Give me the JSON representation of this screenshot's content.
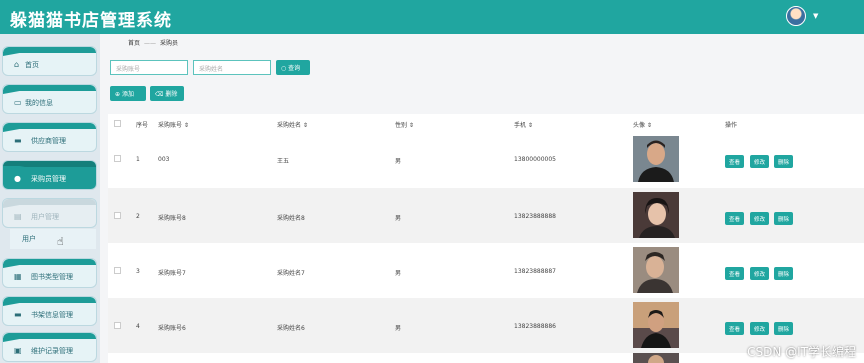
{
  "header": {
    "title": "躲猫猫书店管理系统"
  },
  "sidebar": {
    "items": [
      {
        "label": "首页",
        "icon": "home-icon"
      },
      {
        "label": "我的信息",
        "icon": "profile-icon"
      },
      {
        "label": "供应商管理",
        "icon": "supplier-icon"
      },
      {
        "label": "采购员管理",
        "icon": "user-icon"
      },
      {
        "label": "用户管理",
        "icon": "users-icon"
      },
      {
        "label": "图书类型管理",
        "icon": "grid-icon"
      },
      {
        "label": "书架信息管理",
        "icon": "shelf-icon"
      },
      {
        "label": "维护记录管理",
        "icon": "record-icon"
      }
    ],
    "sub_item": {
      "label": "用户"
    }
  },
  "breadcrumb": {
    "home": "首页",
    "sep": "——",
    "current": "采购员"
  },
  "search": {
    "account_placeholder": "采购账号",
    "name_placeholder": "采购姓名",
    "query_label": "查询"
  },
  "toolbar": {
    "add_label": "添加",
    "delete_label": "删除"
  },
  "table": {
    "headers": [
      "序号",
      "采购账号",
      "采购姓名",
      "性别",
      "手机",
      "头像",
      "操作"
    ],
    "rows": [
      {
        "index": "1",
        "account": "003",
        "name": "王五",
        "gender": "男",
        "phone": "13800000005"
      },
      {
        "index": "2",
        "account": "采购账号8",
        "name": "采购姓名8",
        "gender": "男",
        "phone": "13823888888"
      },
      {
        "index": "3",
        "account": "采购账号7",
        "name": "采购姓名7",
        "gender": "男",
        "phone": "13823888887"
      },
      {
        "index": "4",
        "account": "采购账号6",
        "name": "采购姓名6",
        "gender": "男",
        "phone": "13823888886"
      }
    ],
    "actions": {
      "view": "查看",
      "edit": "修改",
      "delete": "删除"
    }
  },
  "watermark": "CSDN @IT学长编程",
  "colors": {
    "accent": "#20a6a0",
    "header": "#20a6a0"
  }
}
